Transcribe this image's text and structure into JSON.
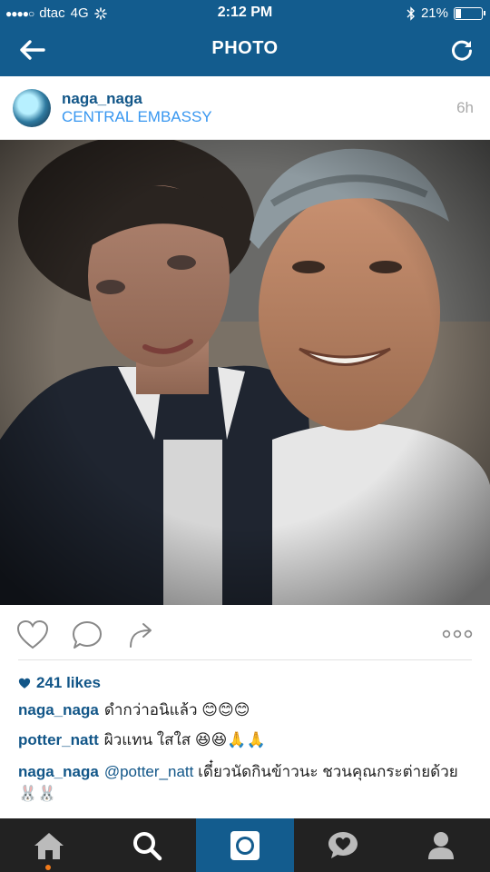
{
  "status_bar": {
    "signal_dots": "●●●●○",
    "carrier": "dtac",
    "network": "4G",
    "time": "2:12 PM",
    "battery_percent": "21%",
    "battery_level": 0.21
  },
  "header": {
    "title": "PHOTO",
    "back_icon": "arrow-left-icon",
    "refresh_icon": "refresh-icon"
  },
  "post": {
    "username": "naga_naga",
    "location": "CENTRAL EMBASSY",
    "time_ago": "6h"
  },
  "actions": {
    "like_icon": "heart-outline-icon",
    "comment_icon": "comment-bubble-icon",
    "share_icon": "share-arrow-icon",
    "more_icon": "more-dots-icon"
  },
  "likes": {
    "count_text": "241 likes"
  },
  "comments": [
    {
      "user": "naga_naga",
      "text": "ดำกว่าอนิแล้ว 😊😊😊"
    },
    {
      "user": "potter_natt",
      "text": "ผิวแทน ใสใส 😆😆🙏🙏"
    },
    {
      "user": "naga_naga",
      "mention": "@potter_natt",
      "text": "เดี๋ยวนัดกินข้าวนะ ชวนคุณกระต่ายด้วย 🐰🐰"
    }
  ],
  "tabbar": {
    "items": [
      "home-icon",
      "search-icon",
      "camera-icon",
      "activity-icon",
      "profile-icon"
    ],
    "active_index": 2
  },
  "colors": {
    "brand_blue": "#135c8e",
    "link_blue": "#125688",
    "location_blue": "#3897f0",
    "tab_dark": "#222222",
    "notify_orange": "#f27a1a"
  }
}
